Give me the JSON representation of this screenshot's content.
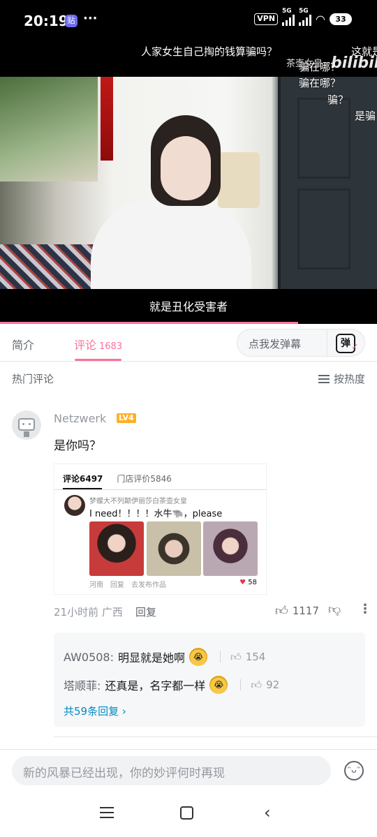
{
  "status_bar": {
    "time": "20:19",
    "app_badge": "贴",
    "dots": "···",
    "vpn": "VPN",
    "network1": "5G",
    "network2": "5G",
    "battery": "33"
  },
  "video": {
    "danmaku": [
      "人家女生自己掏的钱算骗吗？",
      "这就是",
      "茶壶女皇",
      "骗在哪？",
      "骗在哪？",
      "骗？",
      "是骗"
    ],
    "logo": "bilibili",
    "subtitle": "就是丑化受害者",
    "progress": 0.79
  },
  "tabs": {
    "intro": "简介",
    "comments": "评论",
    "comments_count": "1683",
    "danmaku_placeholder": "点我发弹幕",
    "danmaku_btn": "弹"
  },
  "hot_comments": {
    "title": "热门评论",
    "sort": "按热度"
  },
  "comment": {
    "username": "Netzwerk",
    "level": "LV4",
    "text": "是你吗？",
    "embed": {
      "tab_a": "评论6497",
      "tab_b": "门店评价5846",
      "name": "梦蝶大不列颠伊丽莎白茶壶女皇",
      "text": "I need！！！！水牛🐃，please",
      "location": "河南",
      "reply": "回复",
      "publish": "去发布作品",
      "likes": "58"
    },
    "meta": "21小时前 广西",
    "reply": "回复",
    "like_count": "1117",
    "replies": [
      {
        "who": "AW0508:",
        "text": "明显就是她啊",
        "likes": "154"
      },
      {
        "who": "塔顺菲:",
        "text": "还真是，名字都一样",
        "likes": "92"
      }
    ],
    "more_replies": "共59条回复 ›"
  },
  "input": {
    "placeholder": "新的风暴已经出现，你的妙评何时再现"
  }
}
